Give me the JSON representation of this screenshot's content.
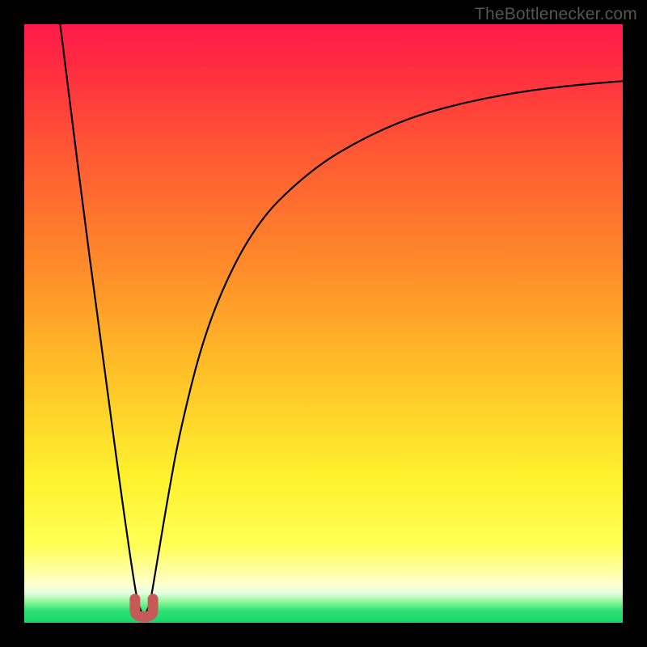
{
  "watermark": "TheBottlenecker.com",
  "colors": {
    "page_bg": "#000000",
    "marker": "#c65a5a",
    "curve": "#000000",
    "watermark_text": "#555555"
  },
  "chart_data": {
    "type": "line",
    "title": "",
    "xlabel": "",
    "ylabel": "",
    "xlim": [
      0,
      100
    ],
    "ylim": [
      0,
      100
    ],
    "grid": false,
    "legend": false,
    "background_gradient": {
      "direction": "vertical",
      "stops": [
        {
          "pct": 0,
          "color": "#ff1a4b"
        },
        {
          "pct": 50,
          "color": "#ffb428"
        },
        {
          "pct": 88,
          "color": "#ffff55"
        },
        {
          "pct": 100,
          "color": "#17d86a"
        }
      ],
      "meaning": "red=high bottleneck, green=low bottleneck"
    },
    "series": [
      {
        "name": "bottleneck-curve",
        "color": "#000000",
        "x": [
          6,
          8,
          10,
          12,
          14,
          16,
          18,
          19,
          20,
          21,
          22,
          24,
          26,
          30,
          35,
          40,
          45,
          50,
          55,
          60,
          65,
          70,
          75,
          80,
          85,
          90,
          95,
          100
        ],
        "y": [
          100,
          84,
          68,
          53,
          38,
          23,
          9,
          3,
          1,
          3,
          9,
          21,
          32,
          48,
          60,
          68,
          73,
          77,
          80,
          82.5,
          84.5,
          86,
          87.2,
          88.2,
          89,
          89.6,
          90.1,
          90.5
        ]
      }
    ],
    "marker": {
      "shape": "u",
      "x_range": [
        18.5,
        21.5
      ],
      "y": 1,
      "color": "#c65a5a",
      "meaning": "optimal / lowest bottleneck point"
    }
  }
}
